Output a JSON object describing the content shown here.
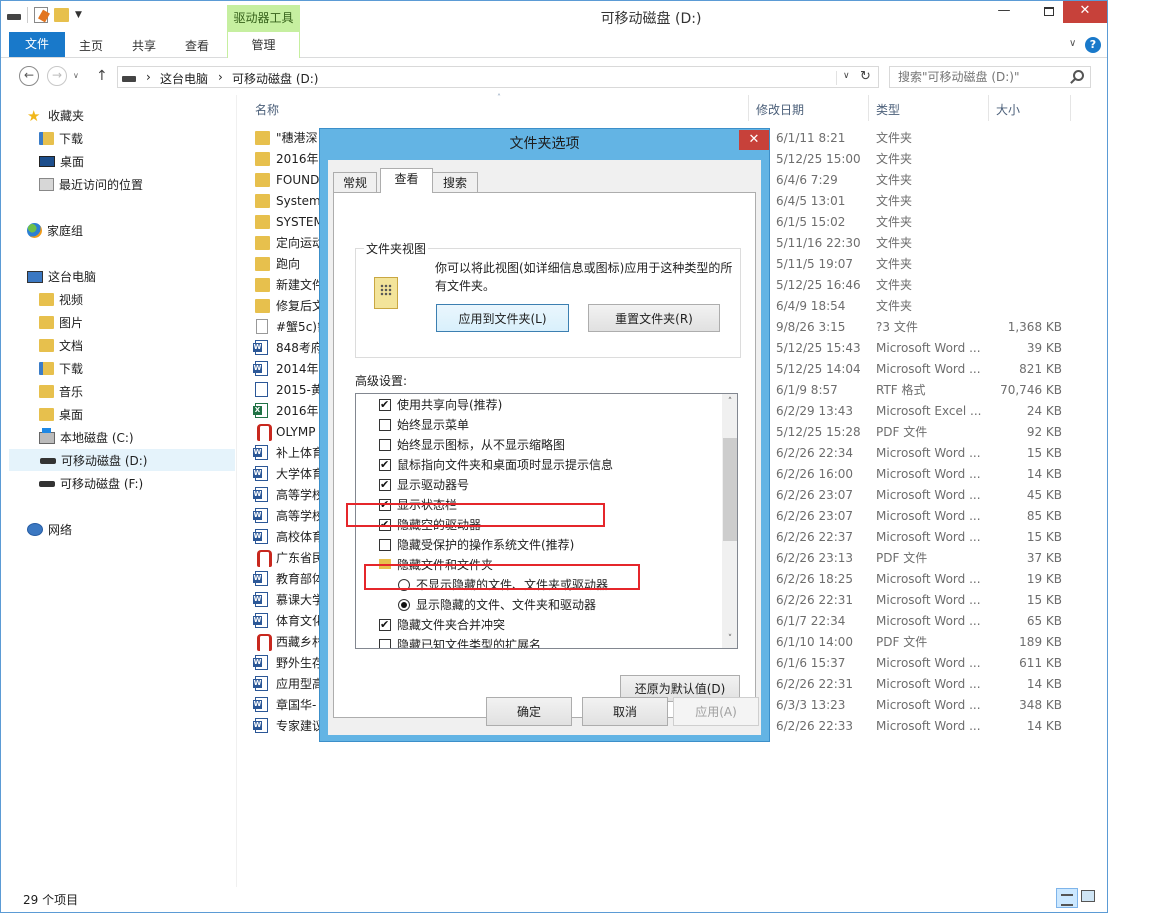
{
  "window": {
    "title": "可移动磁盘 (D:)",
    "context_tab_header": "驱动器工具",
    "min_glyph": "—",
    "close_glyph": "✕"
  },
  "ribbon": {
    "tabs": [
      "文件",
      "主页",
      "共享",
      "查看",
      "管理"
    ],
    "chevron": "∨",
    "help": "?"
  },
  "address": {
    "segments": [
      "这台电脑",
      "可移动磁盘 (D:)"
    ],
    "separator": "›",
    "search_placeholder": "搜索\"可移动磁盘 (D:)\""
  },
  "nav": {
    "back_glyph": "←",
    "forward_glyph": "→",
    "up_glyph": "↑",
    "refresh_glyph": "↻",
    "dropdown_glyph": "∨",
    "favorites": {
      "label": "收藏夹",
      "items": [
        "下载",
        "桌面",
        "最近访问的位置"
      ]
    },
    "homegroup": "家庭组",
    "this_pc": {
      "label": "这台电脑",
      "items": [
        "视频",
        "图片",
        "文档",
        "下载",
        "音乐",
        "桌面",
        "本地磁盘 (C:)",
        "可移动磁盘 (D:)",
        "可移动磁盘 (F:)"
      ]
    },
    "network": "网络"
  },
  "columns": {
    "name": "名称",
    "date": "修改日期",
    "type": "类型",
    "size": "大小",
    "sort_glyph": "˄"
  },
  "files": [
    {
      "name": "\"穗港深",
      "date": "6/1/11 8:21",
      "type": "文件夹",
      "size": "",
      "icon": "folder"
    },
    {
      "name": "2016年",
      "date": "5/12/25 15:00",
      "type": "文件夹",
      "size": "",
      "icon": "folder"
    },
    {
      "name": "FOUND",
      "date": "6/4/6 7:29",
      "type": "文件夹",
      "size": "",
      "icon": "folder"
    },
    {
      "name": "System",
      "date": "6/4/5 13:01",
      "type": "文件夹",
      "size": "",
      "icon": "folder"
    },
    {
      "name": "SYSTEM",
      "date": "6/1/5 15:02",
      "type": "文件夹",
      "size": "",
      "icon": "folder"
    },
    {
      "name": "定向运动",
      "date": "5/11/16 22:30",
      "type": "文件夹",
      "size": "",
      "icon": "folder"
    },
    {
      "name": "跑向",
      "date": "5/11/5 19:07",
      "type": "文件夹",
      "size": "",
      "icon": "folder"
    },
    {
      "name": "新建文件",
      "date": "5/12/25 16:46",
      "type": "文件夹",
      "size": "",
      "icon": "folder"
    },
    {
      "name": "修复后文",
      "date": "6/4/9 18:54",
      "type": "文件夹",
      "size": "",
      "icon": "folder"
    },
    {
      "name": "#蟹5c)氰",
      "date": "9/8/26 3:15",
      "type": "?3 文件",
      "size": "1,368 KB",
      "icon": "file"
    },
    {
      "name": "848考府",
      "date": "5/12/25 15:43",
      "type": "Microsoft Word ...",
      "size": "39 KB",
      "icon": "word"
    },
    {
      "name": "2014年",
      "date": "5/12/25 14:04",
      "type": "Microsoft Word ...",
      "size": "821 KB",
      "icon": "word"
    },
    {
      "name": "2015-黄",
      "date": "6/1/9 8:57",
      "type": "RTF 格式",
      "size": "70,746 KB",
      "icon": "rtf"
    },
    {
      "name": "2016年",
      "date": "6/2/29 13:43",
      "type": "Microsoft Excel ...",
      "size": "24 KB",
      "icon": "excel"
    },
    {
      "name": "OLYMP",
      "date": "5/12/25 15:28",
      "type": "PDF 文件",
      "size": "92 KB",
      "icon": "pdf"
    },
    {
      "name": "补上体育",
      "date": "6/2/26 22:34",
      "type": "Microsoft Word ...",
      "size": "15 KB",
      "icon": "word"
    },
    {
      "name": "大学体育",
      "date": "6/2/26 16:00",
      "type": "Microsoft Word ...",
      "size": "14 KB",
      "icon": "word"
    },
    {
      "name": "高等学校",
      "date": "6/2/26 23:07",
      "type": "Microsoft Word ...",
      "size": "45 KB",
      "icon": "word"
    },
    {
      "name": "高等学校",
      "date": "6/2/26 23:07",
      "type": "Microsoft Word ...",
      "size": "85 KB",
      "icon": "word"
    },
    {
      "name": "高校体育",
      "date": "6/2/26 22:37",
      "type": "Microsoft Word ...",
      "size": "15 KB",
      "icon": "word"
    },
    {
      "name": "广东省民",
      "date": "6/2/26 23:13",
      "type": "PDF 文件",
      "size": "37 KB",
      "icon": "pdf"
    },
    {
      "name": "教育部体",
      "date": "6/2/26 18:25",
      "type": "Microsoft Word ...",
      "size": "19 KB",
      "icon": "word"
    },
    {
      "name": "慕课大学",
      "date": "6/2/26 22:31",
      "type": "Microsoft Word ...",
      "size": "15 KB",
      "icon": "word"
    },
    {
      "name": "体育文化",
      "date": "6/1/7 22:34",
      "type": "Microsoft Word ...",
      "size": "65 KB",
      "icon": "word"
    },
    {
      "name": "西藏乡村",
      "date": "6/1/10 14:00",
      "type": "PDF 文件",
      "size": "189 KB",
      "icon": "pdf"
    },
    {
      "name": "野外生存",
      "date": "6/1/6 15:37",
      "type": "Microsoft Word ...",
      "size": "611 KB",
      "icon": "word"
    },
    {
      "name": "应用型高",
      "date": "6/2/26 22:31",
      "type": "Microsoft Word ...",
      "size": "14 KB",
      "icon": "word"
    },
    {
      "name": "章国华-",
      "date": "6/3/3 13:23",
      "type": "Microsoft Word ...",
      "size": "348 KB",
      "icon": "word"
    },
    {
      "name": "专家建议",
      "date": "6/2/26 22:33",
      "type": "Microsoft Word ...",
      "size": "14 KB",
      "icon": "word"
    }
  ],
  "status": {
    "count": "29 个项目"
  },
  "dialog": {
    "title": "文件夹选项",
    "close_glyph": "✕",
    "tabs": [
      "常规",
      "查看",
      "搜索"
    ],
    "folder_views": {
      "title": "文件夹视图",
      "description": "你可以将此视图(如详细信息或图标)应用于这种类型的所有文件夹。",
      "apply_button": "应用到文件夹(L)",
      "reset_button": "重置文件夹(R)"
    },
    "advanced_label": "高级设置:",
    "advanced_items": [
      {
        "control": "checkbox",
        "checked": true,
        "indent": 1,
        "label": "使用共享向导(推荐)"
      },
      {
        "control": "checkbox",
        "checked": false,
        "indent": 1,
        "label": "始终显示菜单"
      },
      {
        "control": "checkbox",
        "checked": false,
        "indent": 1,
        "label": "始终显示图标，从不显示缩略图"
      },
      {
        "control": "checkbox",
        "checked": true,
        "indent": 1,
        "label": "鼠标指向文件夹和桌面项时显示提示信息"
      },
      {
        "control": "checkbox",
        "checked": true,
        "indent": 1,
        "label": "显示驱动器号"
      },
      {
        "control": "checkbox",
        "checked": true,
        "indent": 1,
        "label": "显示状态栏"
      },
      {
        "control": "checkbox",
        "checked": true,
        "indent": 1,
        "label": "隐藏空的驱动器"
      },
      {
        "control": "checkbox",
        "checked": false,
        "indent": 1,
        "label": "隐藏受保护的操作系统文件(推荐)"
      },
      {
        "control": "folder",
        "checked": false,
        "indent": 1,
        "label": "隐藏文件和文件夹"
      },
      {
        "control": "radio",
        "checked": false,
        "indent": 2,
        "label": "不显示隐藏的文件、文件夹或驱动器"
      },
      {
        "control": "radio",
        "checked": true,
        "indent": 2,
        "label": "显示隐藏的文件、文件夹和驱动器"
      },
      {
        "control": "checkbox",
        "checked": true,
        "indent": 1,
        "label": "隐藏文件夹合并冲突"
      },
      {
        "control": "checkbox",
        "checked": false,
        "indent": 1,
        "label": "隐藏已知文件类型的扩展名"
      }
    ],
    "scroll_up": "˄",
    "scroll_down": "˅",
    "restore_button": "还原为默认值(D)",
    "ok_button": "确定",
    "cancel_button": "取消",
    "apply_button": "应用(A)"
  },
  "colors": {
    "accent": "#1979ca",
    "dialog_frame": "#63b4e4",
    "context_tab": "#c6efa0",
    "close_red": "#c7413a",
    "highlight_box": "#e5262b"
  }
}
